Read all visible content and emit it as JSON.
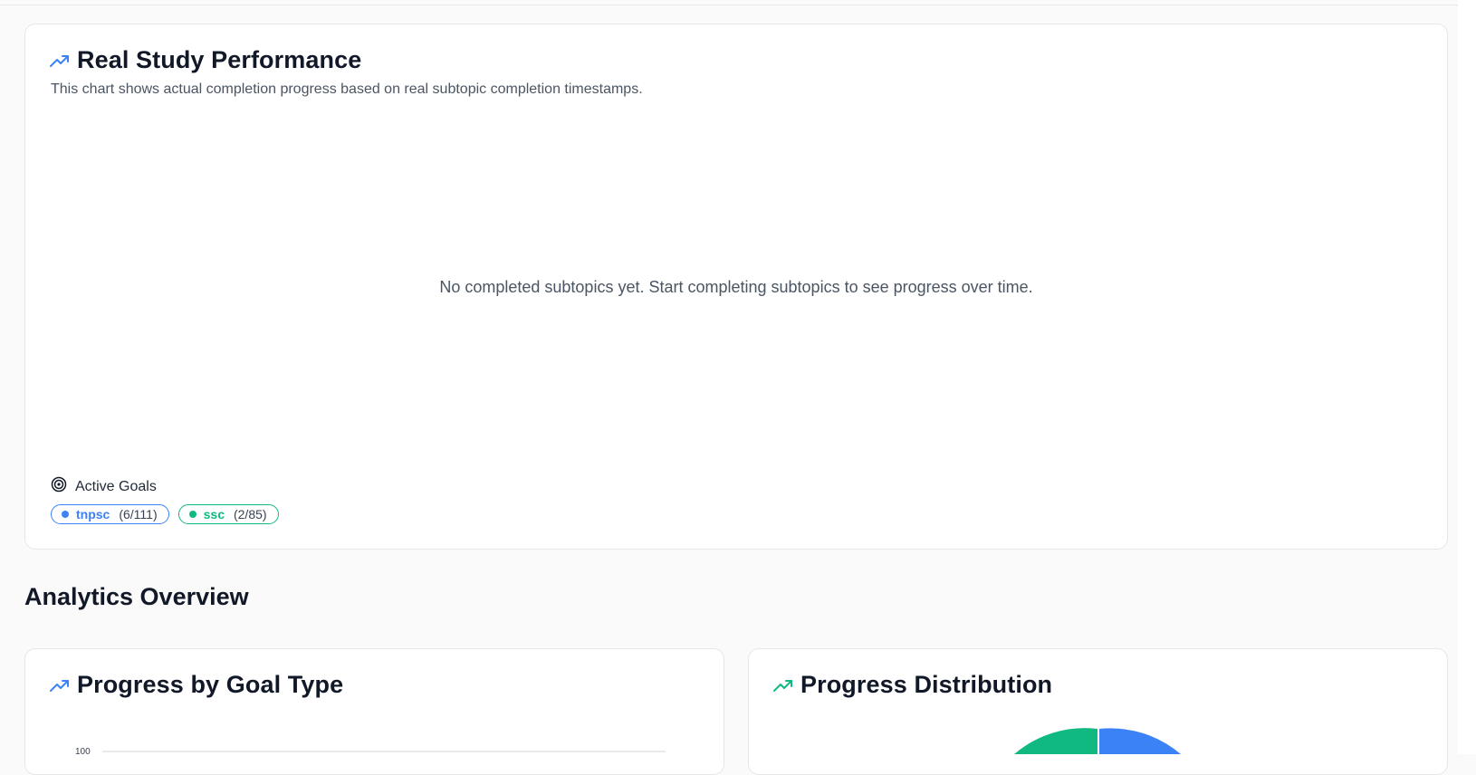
{
  "performance": {
    "title": "Real Study Performance",
    "description": "This chart shows actual completion progress based on real subtopic completion timestamps.",
    "empty_message": "No completed subtopics yet. Start completing subtopics to see progress over time.",
    "active_goals_label": "Active Goals",
    "goals": [
      {
        "name": "tnpsc",
        "count": "(6/111)",
        "color": "#3b82f6"
      },
      {
        "name": "ssc",
        "count": "(2/85)",
        "color": "#10b981"
      }
    ]
  },
  "analytics": {
    "section_title": "Analytics Overview",
    "goal_type_card": {
      "title": "Progress by Goal Type",
      "y_tick_top": "100"
    },
    "distribution_card": {
      "title": "Progress Distribution"
    }
  },
  "colors": {
    "accent_blue": "#3b82f6",
    "accent_green": "#10b981"
  },
  "chart_data": {
    "type": "pie",
    "note_visible_slices": [
      "#10b981",
      "#3b82f6"
    ]
  }
}
